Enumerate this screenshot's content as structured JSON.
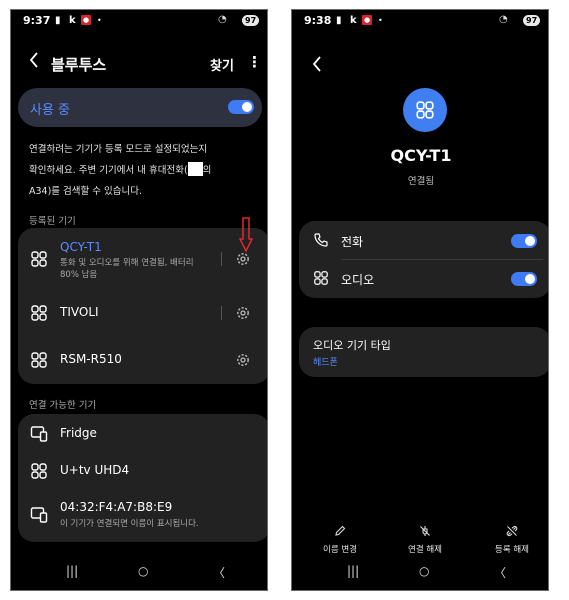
{
  "left": {
    "status": {
      "time": "9:37",
      "k": "k",
      "battery": "97"
    },
    "header": {
      "title": "블루투스",
      "find": "찾기",
      "more": "⋮"
    },
    "in_use": {
      "label": "사용 중",
      "enabled": true
    },
    "description": {
      "line1": "연결하려는 기기가 등록 모드로 설정되었는지",
      "line2a": "확인하세요. 주변 기기에서 내 휴대전화(",
      "line2b": "의",
      "line3": "A34)를 검색할 수 있습니다."
    },
    "registered_section": "등록된 기기",
    "registered": [
      {
        "name": "QCY-T1",
        "sub": "통화 및 오디오를 위해 연결됨, 배터리 80% 남음",
        "icon": "earbuds-icon"
      },
      {
        "name": "TIVOLI",
        "icon": "earbuds-icon"
      },
      {
        "name": "RSM-R510",
        "icon": "earbuds-icon"
      }
    ],
    "available_section": "연결 가능한 기기",
    "available": [
      {
        "name": "Fridge",
        "icon": "tablet-icon"
      },
      {
        "name": "U+tv UHD4",
        "icon": "earbuds-icon"
      },
      {
        "name": "04:32:F4:A7:B8:E9",
        "sub": "이 기기가 연결되면 이름이 표시됩니다.",
        "icon": "tablet-icon"
      }
    ],
    "nav": {
      "recents": "|||",
      "home": "○",
      "back": "〈"
    }
  },
  "right": {
    "status": {
      "time": "9:38",
      "k": "k",
      "battery": "97"
    },
    "device_name": "QCY-T1",
    "device_status": "연결됨",
    "profiles": [
      {
        "label": "전화",
        "icon": "phone-icon",
        "enabled": true
      },
      {
        "label": "오디오",
        "icon": "earbuds-icon",
        "enabled": true
      }
    ],
    "audio_type": {
      "title": "오디오 기기 타입",
      "value": "헤드폰"
    },
    "actions": [
      {
        "label": "이름 변경",
        "icon": "pencil-icon"
      },
      {
        "label": "연결 해제",
        "icon": "disconnect-icon"
      },
      {
        "label": "등록 해제",
        "icon": "unpair-icon"
      }
    ],
    "nav": {
      "recents": "|||",
      "home": "○",
      "back": "〈"
    }
  },
  "colors": {
    "accent": "#3e7bf5",
    "accent_text": "#5a8cff",
    "card": "#222222",
    "inuse_bg": "#2e3140",
    "annotation": "#e0282c"
  }
}
